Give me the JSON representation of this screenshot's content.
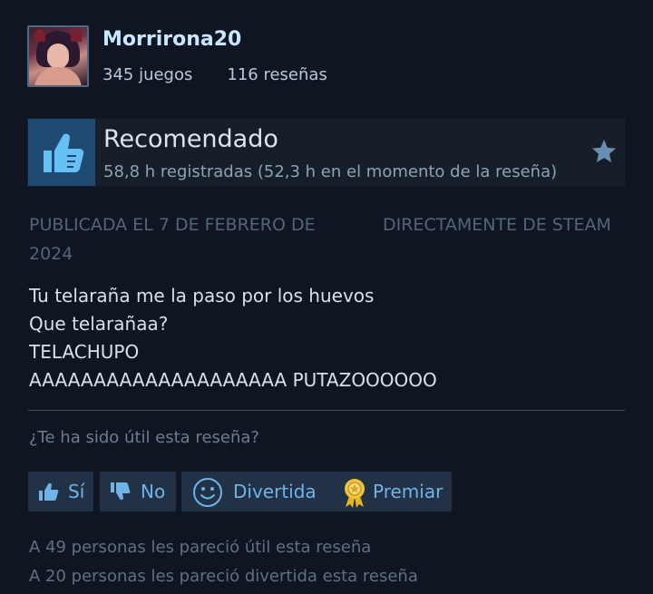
{
  "profile": {
    "username": "Morrirona20",
    "games": "345 juegos",
    "reviews": "116 reseñas"
  },
  "recommendation": {
    "title": "Recomendado",
    "hours": "58,8 h registradas (52,3 h en el momento de la reseña)"
  },
  "meta": {
    "published": "PUBLICADA EL 7 DE FEBRERO DE 2024",
    "source": "DIRECTAMENTE DE STEAM"
  },
  "review": {
    "lines": [
      "Tu telaraña me la paso por los huevos",
      "Que telarañaa?",
      "TELACHUPO",
      "AAAAAAAAAAAAAAAAAAAA PUTAZOOOOOO"
    ]
  },
  "helpful": {
    "question": "¿Te ha sido útil esta reseña?",
    "yes_label": "Sí",
    "no_label": "No",
    "funny_label": "Divertida",
    "award_label": "Premiar"
  },
  "footer": {
    "helpful_count": "A 49 personas les pareció útil esta reseña",
    "funny_count": "A 20 personas les pareció divertida esta reseña"
  },
  "colors": {
    "background": "#0f1521",
    "accent": "#6fb3e8",
    "button_bg": "#213246",
    "thumb_bg": "#1f4a73"
  }
}
